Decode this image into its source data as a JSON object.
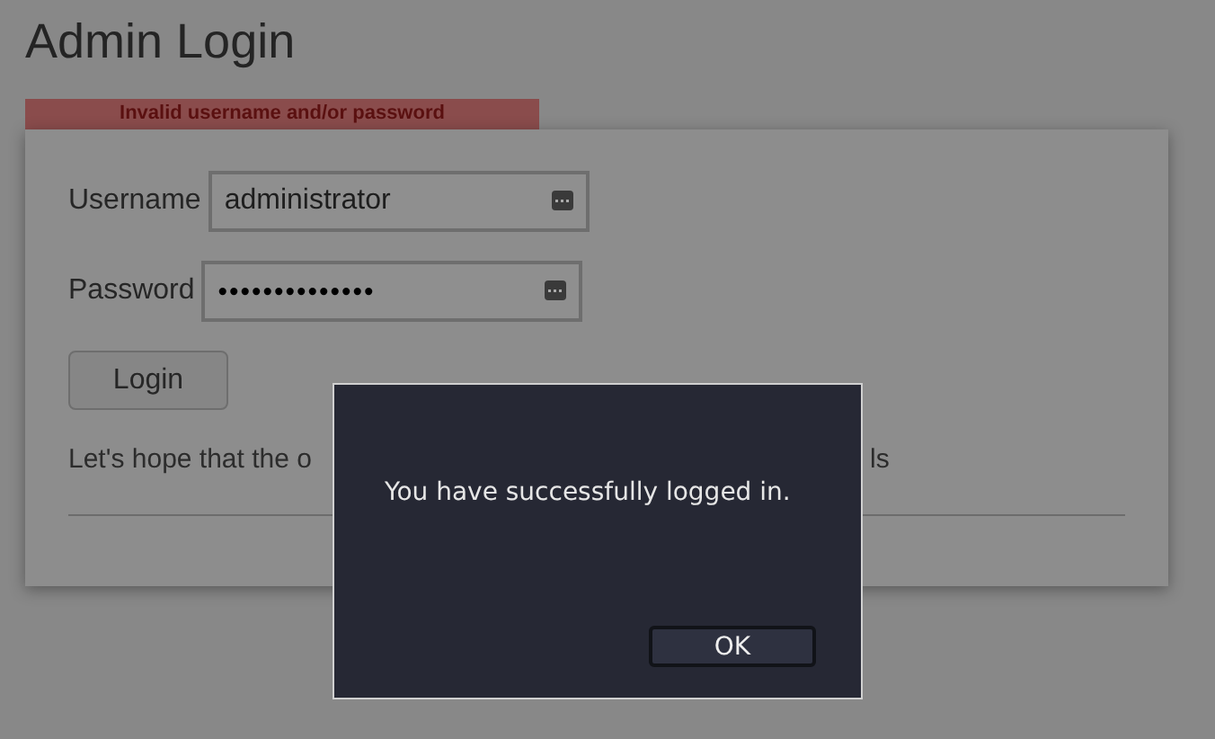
{
  "page": {
    "title": "Admin Login",
    "error": "Invalid username and/or password",
    "username": {
      "label": "Username",
      "value": "administrator"
    },
    "password": {
      "label": "Password",
      "value": "••••••••••••••"
    },
    "login_button": "Login",
    "note_left": "Let's hope that the o",
    "note_right": "ls"
  },
  "dialog": {
    "message": "You have successfully logged in.",
    "ok_button": "OK"
  }
}
